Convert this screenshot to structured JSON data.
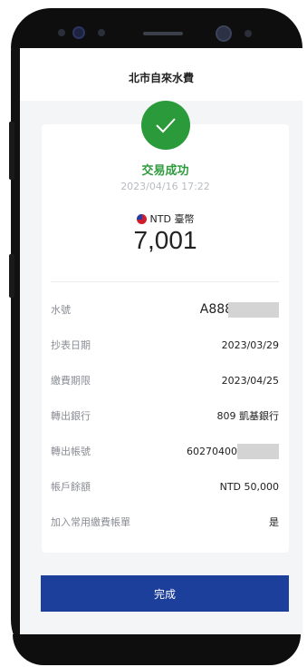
{
  "header": {
    "title": "北市自來水費"
  },
  "result": {
    "status": "交易成功",
    "timestamp": "2023/04/16 17:22",
    "currency": "NTD 臺幣",
    "amount": "7,001"
  },
  "details": [
    {
      "label": "水號",
      "value": "A8888",
      "masked": true
    },
    {
      "label": "抄表日期",
      "value": "2023/03/29"
    },
    {
      "label": "繳費期限",
      "value": "2023/04/25"
    },
    {
      "label": "轉出銀行",
      "value": "809 凱基銀行"
    },
    {
      "label": "轉出帳號",
      "value": "60270400",
      "masked": true
    },
    {
      "label": "帳戶餘額",
      "value": "NTD 50,000"
    },
    {
      "label": "加入常用繳費帳單",
      "value": "是"
    }
  ],
  "actions": {
    "done_label": "完成"
  },
  "colors": {
    "success": "#2b9a3a",
    "primary": "#1d3f9c"
  },
  "icons": {
    "status_icon": "check-icon",
    "currency_icon": "taiwan-flag-icon"
  }
}
